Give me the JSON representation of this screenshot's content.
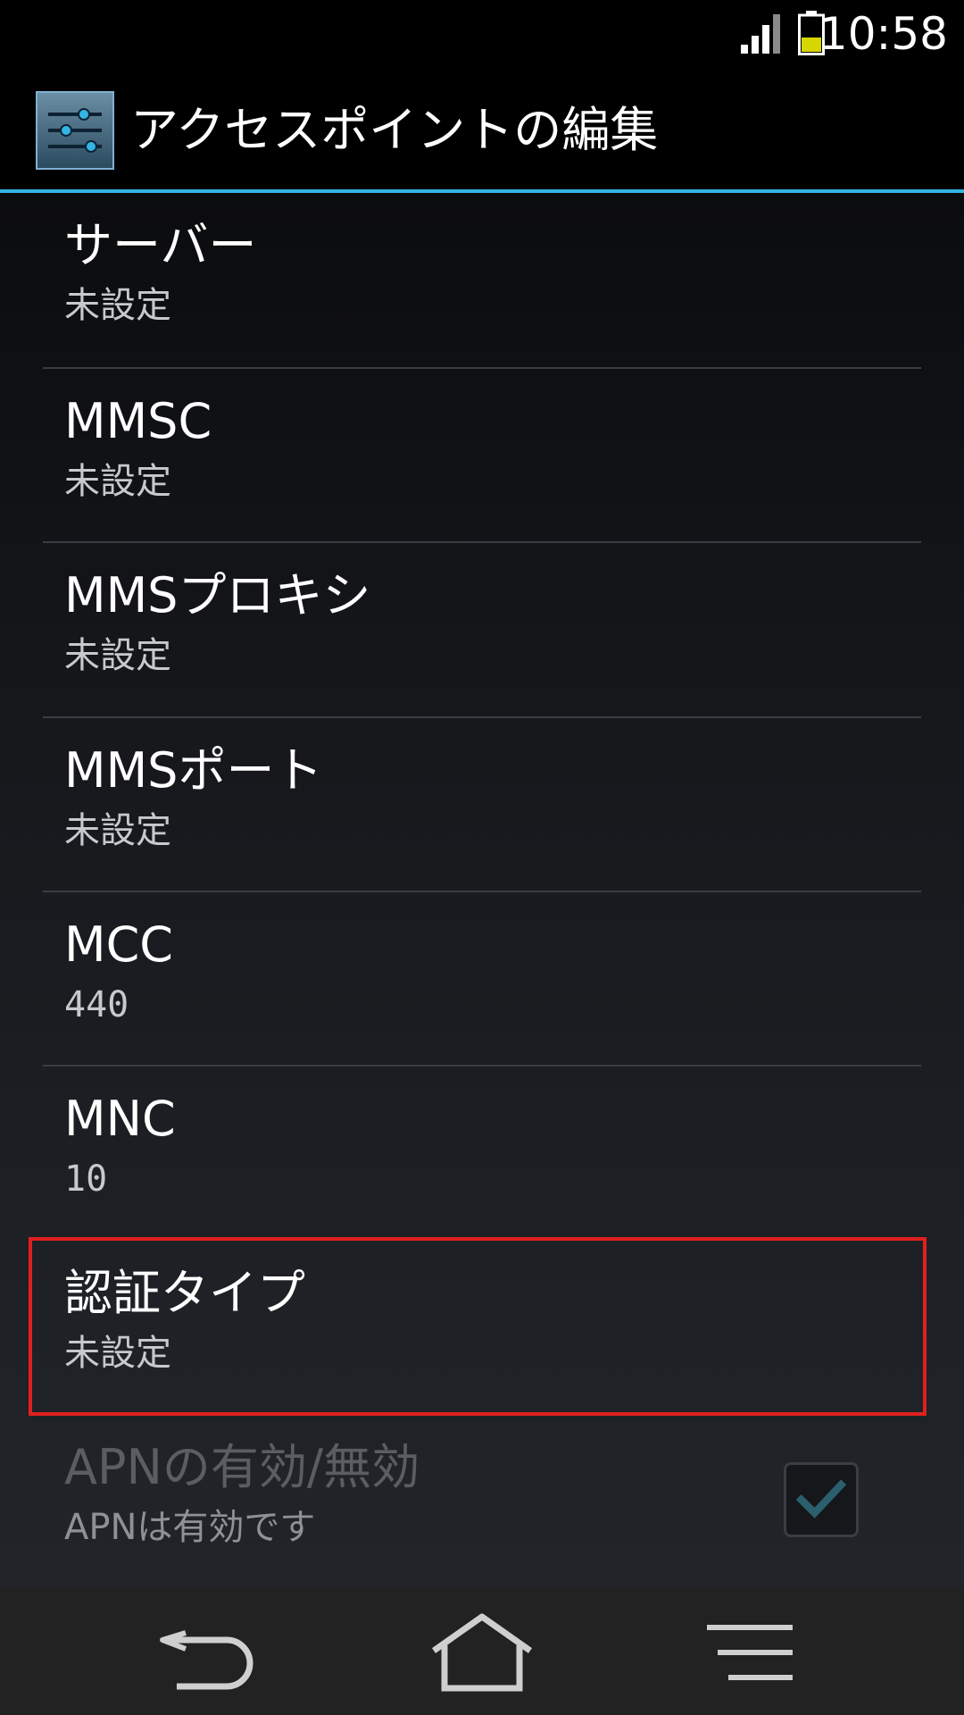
{
  "status_bar": {
    "time": "10:58",
    "signal_icon": "signal-icon",
    "battery_icon": "battery-icon",
    "battery_color": "#d6d600"
  },
  "action_bar": {
    "title": "アクセスポイントの編集",
    "icon": "settings-sliders-icon",
    "accent_color": "#33b5e5"
  },
  "settings": {
    "items": [
      {
        "title": "サーバー",
        "summary": "未設定"
      },
      {
        "title": "MMSC",
        "summary": "未設定"
      },
      {
        "title": "MMSプロキシ",
        "summary": "未設定"
      },
      {
        "title": "MMSポート",
        "summary": "未設定"
      },
      {
        "title": "MCC",
        "summary": "440"
      },
      {
        "title": "MNC",
        "summary": "10"
      },
      {
        "title": "認証タイプ",
        "summary": "未設定"
      }
    ],
    "apn_toggle": {
      "title": "APNの有効/無効",
      "summary": "APNは有効です",
      "checked": true,
      "enabled": false
    },
    "highlight_color": "#e0201f"
  },
  "nav_bar": {
    "back_icon": "back-icon",
    "home_icon": "home-icon",
    "menu_icon": "menu-icon"
  }
}
